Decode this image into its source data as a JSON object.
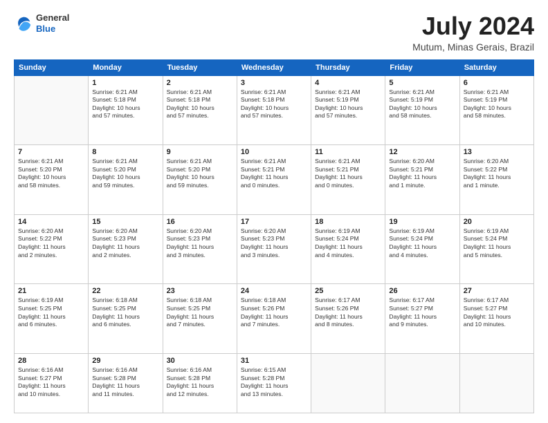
{
  "header": {
    "logo_line1": "General",
    "logo_line2": "Blue",
    "month": "July 2024",
    "location": "Mutum, Minas Gerais, Brazil"
  },
  "weekdays": [
    "Sunday",
    "Monday",
    "Tuesday",
    "Wednesday",
    "Thursday",
    "Friday",
    "Saturday"
  ],
  "weeks": [
    [
      {
        "day": "",
        "info": ""
      },
      {
        "day": "1",
        "info": "Sunrise: 6:21 AM\nSunset: 5:18 PM\nDaylight: 10 hours\nand 57 minutes."
      },
      {
        "day": "2",
        "info": "Sunrise: 6:21 AM\nSunset: 5:18 PM\nDaylight: 10 hours\nand 57 minutes."
      },
      {
        "day": "3",
        "info": "Sunrise: 6:21 AM\nSunset: 5:18 PM\nDaylight: 10 hours\nand 57 minutes."
      },
      {
        "day": "4",
        "info": "Sunrise: 6:21 AM\nSunset: 5:19 PM\nDaylight: 10 hours\nand 57 minutes."
      },
      {
        "day": "5",
        "info": "Sunrise: 6:21 AM\nSunset: 5:19 PM\nDaylight: 10 hours\nand 58 minutes."
      },
      {
        "day": "6",
        "info": "Sunrise: 6:21 AM\nSunset: 5:19 PM\nDaylight: 10 hours\nand 58 minutes."
      }
    ],
    [
      {
        "day": "7",
        "info": "Sunrise: 6:21 AM\nSunset: 5:20 PM\nDaylight: 10 hours\nand 58 minutes."
      },
      {
        "day": "8",
        "info": "Sunrise: 6:21 AM\nSunset: 5:20 PM\nDaylight: 10 hours\nand 59 minutes."
      },
      {
        "day": "9",
        "info": "Sunrise: 6:21 AM\nSunset: 5:20 PM\nDaylight: 10 hours\nand 59 minutes."
      },
      {
        "day": "10",
        "info": "Sunrise: 6:21 AM\nSunset: 5:21 PM\nDaylight: 11 hours\nand 0 minutes."
      },
      {
        "day": "11",
        "info": "Sunrise: 6:21 AM\nSunset: 5:21 PM\nDaylight: 11 hours\nand 0 minutes."
      },
      {
        "day": "12",
        "info": "Sunrise: 6:20 AM\nSunset: 5:21 PM\nDaylight: 11 hours\nand 1 minute."
      },
      {
        "day": "13",
        "info": "Sunrise: 6:20 AM\nSunset: 5:22 PM\nDaylight: 11 hours\nand 1 minute."
      }
    ],
    [
      {
        "day": "14",
        "info": "Sunrise: 6:20 AM\nSunset: 5:22 PM\nDaylight: 11 hours\nand 2 minutes."
      },
      {
        "day": "15",
        "info": "Sunrise: 6:20 AM\nSunset: 5:23 PM\nDaylight: 11 hours\nand 2 minutes."
      },
      {
        "day": "16",
        "info": "Sunrise: 6:20 AM\nSunset: 5:23 PM\nDaylight: 11 hours\nand 3 minutes."
      },
      {
        "day": "17",
        "info": "Sunrise: 6:20 AM\nSunset: 5:23 PM\nDaylight: 11 hours\nand 3 minutes."
      },
      {
        "day": "18",
        "info": "Sunrise: 6:19 AM\nSunset: 5:24 PM\nDaylight: 11 hours\nand 4 minutes."
      },
      {
        "day": "19",
        "info": "Sunrise: 6:19 AM\nSunset: 5:24 PM\nDaylight: 11 hours\nand 4 minutes."
      },
      {
        "day": "20",
        "info": "Sunrise: 6:19 AM\nSunset: 5:24 PM\nDaylight: 11 hours\nand 5 minutes."
      }
    ],
    [
      {
        "day": "21",
        "info": "Sunrise: 6:19 AM\nSunset: 5:25 PM\nDaylight: 11 hours\nand 6 minutes."
      },
      {
        "day": "22",
        "info": "Sunrise: 6:18 AM\nSunset: 5:25 PM\nDaylight: 11 hours\nand 6 minutes."
      },
      {
        "day": "23",
        "info": "Sunrise: 6:18 AM\nSunset: 5:25 PM\nDaylight: 11 hours\nand 7 minutes."
      },
      {
        "day": "24",
        "info": "Sunrise: 6:18 AM\nSunset: 5:26 PM\nDaylight: 11 hours\nand 7 minutes."
      },
      {
        "day": "25",
        "info": "Sunrise: 6:17 AM\nSunset: 5:26 PM\nDaylight: 11 hours\nand 8 minutes."
      },
      {
        "day": "26",
        "info": "Sunrise: 6:17 AM\nSunset: 5:27 PM\nDaylight: 11 hours\nand 9 minutes."
      },
      {
        "day": "27",
        "info": "Sunrise: 6:17 AM\nSunset: 5:27 PM\nDaylight: 11 hours\nand 10 minutes."
      }
    ],
    [
      {
        "day": "28",
        "info": "Sunrise: 6:16 AM\nSunset: 5:27 PM\nDaylight: 11 hours\nand 10 minutes."
      },
      {
        "day": "29",
        "info": "Sunrise: 6:16 AM\nSunset: 5:28 PM\nDaylight: 11 hours\nand 11 minutes."
      },
      {
        "day": "30",
        "info": "Sunrise: 6:16 AM\nSunset: 5:28 PM\nDaylight: 11 hours\nand 12 minutes."
      },
      {
        "day": "31",
        "info": "Sunrise: 6:15 AM\nSunset: 5:28 PM\nDaylight: 11 hours\nand 13 minutes."
      },
      {
        "day": "",
        "info": ""
      },
      {
        "day": "",
        "info": ""
      },
      {
        "day": "",
        "info": ""
      }
    ]
  ]
}
